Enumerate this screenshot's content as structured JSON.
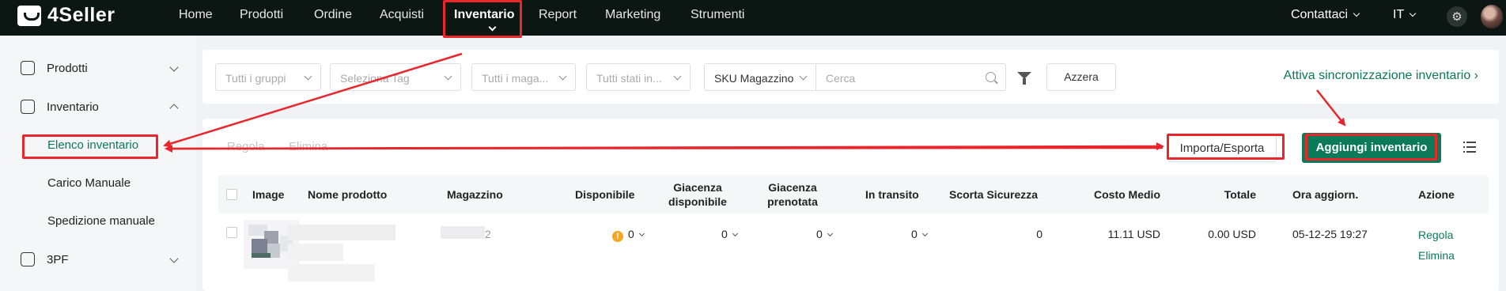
{
  "app": {
    "name": "4Seller"
  },
  "topnav": {
    "items": [
      "Home",
      "Prodotti",
      "Ordine",
      "Acquisti",
      "Inventario",
      "Report",
      "Marketing",
      "Strumenti"
    ],
    "active": "Inventario",
    "contact": "Contattaci",
    "language": "IT"
  },
  "sidebar": {
    "groups": [
      {
        "label": "Prodotti",
        "icon": "bag-icon"
      },
      {
        "label": "Inventario",
        "icon": "warehouse-icon"
      },
      {
        "label": "3PF",
        "icon": "box-icon"
      }
    ],
    "inventory_items": [
      "Elenco inventario",
      "Carico Manuale",
      "Spedizione manuale"
    ],
    "active_item": "Elenco inventario"
  },
  "filters": {
    "groups_placeholder": "Tutti i gruppi",
    "tag_placeholder": "Seleziona Tag",
    "warehouse_placeholder": "Tutti i maga...",
    "status_placeholder": "Tutti stati in...",
    "search_field": "SKU Magazzino",
    "search_placeholder": "Cerca",
    "reset_label": "Azzera",
    "sync_link": "Attiva sincronizzazione inventario"
  },
  "toolbar": {
    "adjust_label": "Regola",
    "delete_label": "Elimina",
    "import_export_label": "Importa/Esporta",
    "add_label": "Aggiungi inventario"
  },
  "table": {
    "headers": {
      "image": "Image",
      "name": "Nome prodotto",
      "warehouse": "Magazzino",
      "available": "Disponibile",
      "stock_available": "Giacenza disponibile",
      "stock_reserved": "Giacenza prenotata",
      "in_transit": "In transito",
      "safety_stock": "Scorta Sicurezza",
      "avg_cost": "Costo Medio",
      "total": "Totale",
      "updated": "Ora aggiorn.",
      "action": "Azione"
    },
    "rows": [
      {
        "warehouse_suffix": "2",
        "available": "0",
        "stock_available": "0",
        "stock_reserved": "0",
        "in_transit": "0",
        "safety_stock": "0",
        "avg_cost": "11.11 USD",
        "total": "0.00 USD",
        "updated": "05-12-25 19:27",
        "action_adjust": "Regola",
        "action_delete": "Elimina"
      }
    ]
  },
  "colors": {
    "brand_green": "#0b7a58",
    "topbar": "#0c1613",
    "annotation_red": "#e8262c"
  }
}
